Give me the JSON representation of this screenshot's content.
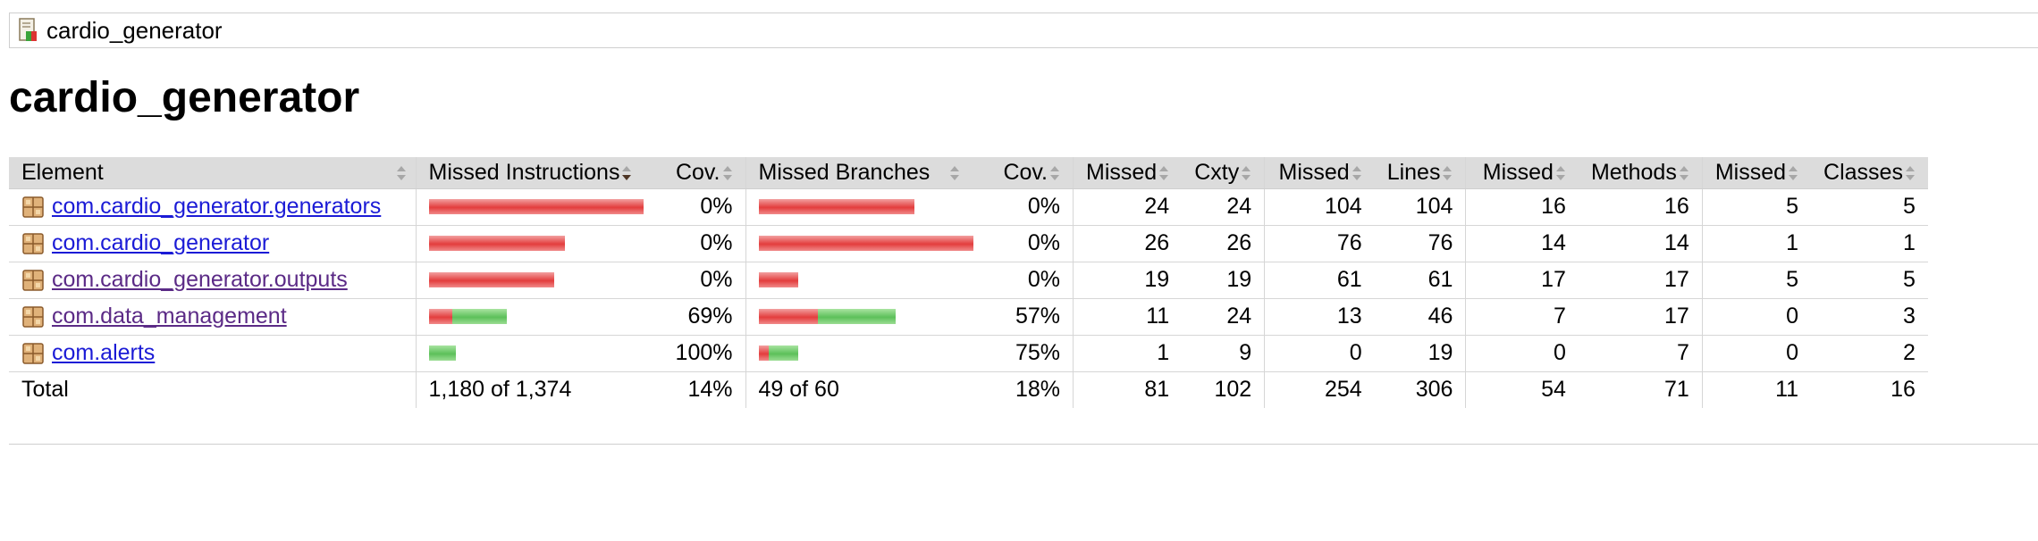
{
  "breadcrumb": {
    "label": "cardio_generator",
    "icon": "report-icon"
  },
  "page_title": "cardio_generator",
  "columns": {
    "element": "Element",
    "missed_instructions": "Missed Instructions",
    "cov_instr": "Cov.",
    "missed_branches": "Missed Branches",
    "cov_branch": "Cov.",
    "missed_cxty": "Missed",
    "cxty": "Cxty",
    "missed_lines": "Missed",
    "lines": "Lines",
    "missed_methods": "Missed",
    "methods": "Methods",
    "missed_classes": "Missed",
    "classes": "Classes"
  },
  "colors": {
    "missed": "#e33d3d",
    "covered": "#5cc05a",
    "header_bg": "#dcdcdc",
    "link": "#1b1bd6",
    "visited": "#5b2a86"
  },
  "rows": [
    {
      "name": "com.cardio_generator.generators",
      "visited": false,
      "instr_missed_frac": 1.0,
      "instr_covered_frac": 0.0,
      "cov_instr": "0%",
      "branch_missed_frac": 0.727,
      "branch_covered_frac": 0.0,
      "cov_branch": "0%",
      "missed_cxty": "24",
      "cxty": "24",
      "missed_lines": "104",
      "lines": "104",
      "missed_methods": "16",
      "methods": "16",
      "missed_classes": "5",
      "classes": "5"
    },
    {
      "name": "com.cardio_generator",
      "visited": false,
      "instr_missed_frac": 0.633,
      "instr_covered_frac": 0.0,
      "cov_instr": "0%",
      "branch_missed_frac": 1.0,
      "branch_covered_frac": 0.0,
      "cov_branch": "0%",
      "missed_cxty": "26",
      "cxty": "26",
      "missed_lines": "76",
      "lines": "76",
      "missed_methods": "14",
      "methods": "14",
      "missed_classes": "1",
      "classes": "1"
    },
    {
      "name": "com.cardio_generator.outputs",
      "visited": true,
      "instr_missed_frac": 0.584,
      "instr_covered_frac": 0.0,
      "cov_instr": "0%",
      "branch_missed_frac": 0.182,
      "branch_covered_frac": 0.0,
      "cov_branch": "0%",
      "missed_cxty": "19",
      "cxty": "19",
      "missed_lines": "61",
      "lines": "61",
      "missed_methods": "17",
      "methods": "17",
      "missed_classes": "5",
      "classes": "5"
    },
    {
      "name": "com.data_management",
      "visited": true,
      "instr_missed_frac": 0.108,
      "instr_covered_frac": 0.253,
      "cov_instr": "69%",
      "branch_missed_frac": 0.273,
      "branch_covered_frac": 0.364,
      "cov_branch": "57%",
      "missed_cxty": "11",
      "cxty": "24",
      "missed_lines": "13",
      "lines": "46",
      "missed_methods": "7",
      "methods": "17",
      "missed_classes": "0",
      "classes": "3"
    },
    {
      "name": "com.alerts",
      "visited": false,
      "instr_missed_frac": 0.0,
      "instr_covered_frac": 0.127,
      "cov_instr": "100%",
      "branch_missed_frac": 0.045,
      "branch_covered_frac": 0.136,
      "cov_branch": "75%",
      "missed_cxty": "1",
      "cxty": "9",
      "missed_lines": "0",
      "lines": "19",
      "missed_methods": "0",
      "methods": "7",
      "missed_classes": "0",
      "classes": "2"
    }
  ],
  "total": {
    "label": "Total",
    "missed_instructions": "1,180 of 1,374",
    "cov_instr": "14%",
    "missed_branches": "49 of 60",
    "cov_branch": "18%",
    "missed_cxty": "81",
    "cxty": "102",
    "missed_lines": "254",
    "lines": "306",
    "missed_methods": "54",
    "methods": "71",
    "missed_classes": "11",
    "classes": "16"
  }
}
